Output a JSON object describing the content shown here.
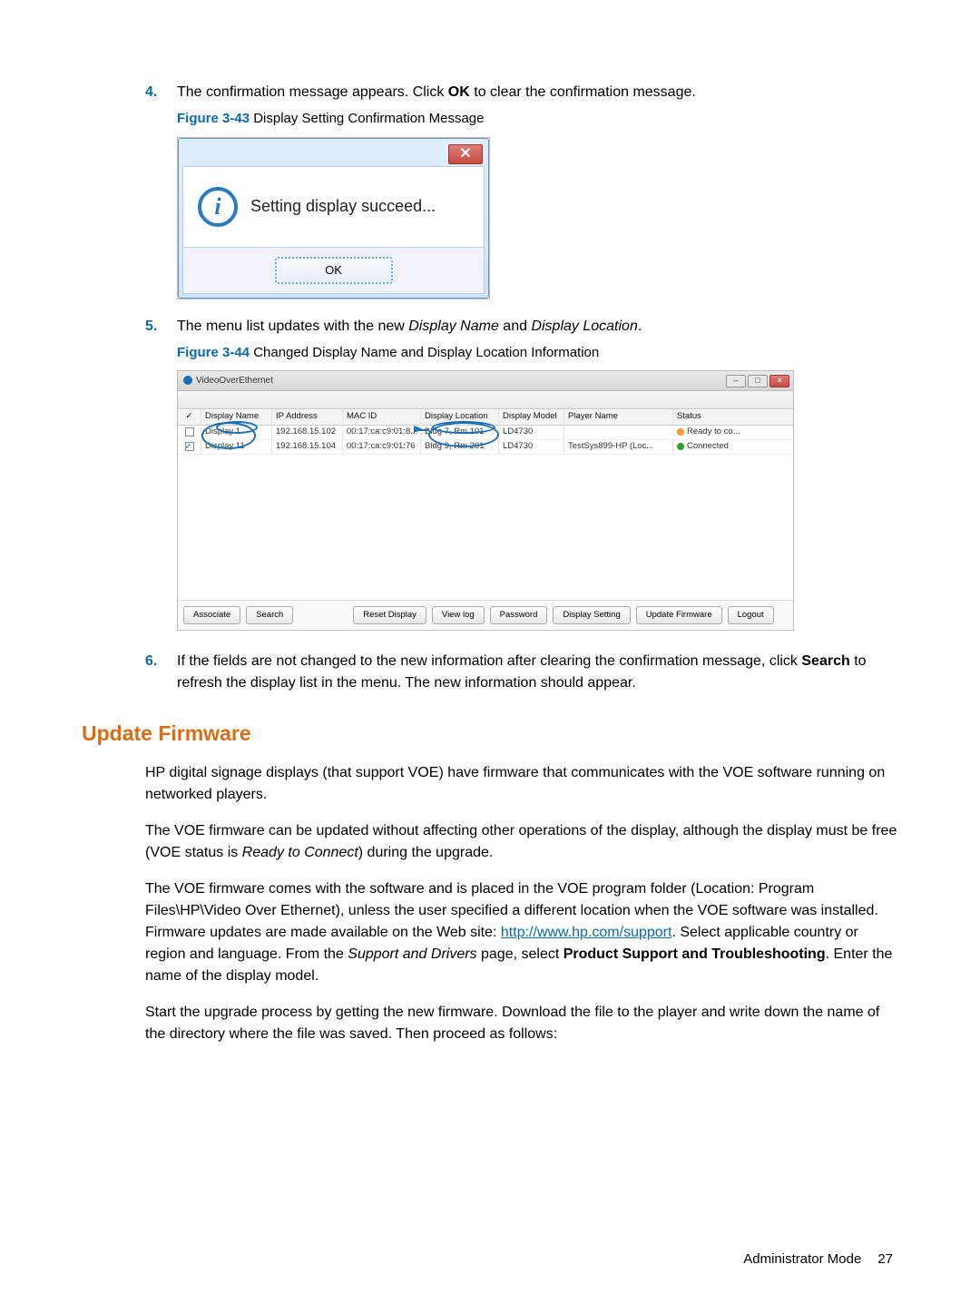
{
  "steps": {
    "s4": {
      "num": "4.",
      "text_a": "The confirmation message appears. Click ",
      "text_b": "OK",
      "text_c": " to clear the confirmation message."
    },
    "s5": {
      "num": "5.",
      "text_a": "The menu list updates with the new ",
      "i1": "Display Name",
      "text_b": " and ",
      "i2": "Display Location",
      "text_c": "."
    },
    "s6": {
      "num": "6.",
      "text_a": "If the fields are not changed to the new information after clearing the confirmation message, click ",
      "b1": "Search",
      "text_b": " to refresh the display list in the menu. The new information should appear."
    }
  },
  "fig43": {
    "prefix": "Figure 3-43",
    "caption": "  Display Setting Confirmation Message",
    "title": "",
    "message": "Setting display succeed...",
    "ok": "OK"
  },
  "fig44": {
    "prefix": "Figure 3-44",
    "caption": "  Changed Display Name and Display Location Information",
    "app_title": "VideoOverEthernet",
    "columns": {
      "chk": "✓",
      "name": "Display Name",
      "ip": "IP Address",
      "mac": "MAC ID",
      "loc": "Display Location",
      "model": "Display Model",
      "player": "Player Name",
      "status": "Status"
    },
    "rows": [
      {
        "checked": false,
        "name": "Display 1",
        "ip": "192.168.15.102",
        "mac": "00:17:ca:c9:01:8...",
        "loc": "Bldg 7, Rm 101",
        "model": "LD4730",
        "player": "",
        "status_icon": "info",
        "status": "Ready to co..."
      },
      {
        "checked": true,
        "name": "Display 11",
        "ip": "192.168.15.104",
        "mac": "00:17:ca:c9:01:76",
        "loc": "Bldg 9, Rm 201",
        "model": "LD4730",
        "player": "TestSys899-HP (Loc...",
        "status_icon": "ok",
        "status": "Connected"
      }
    ],
    "buttons": {
      "associate": "Associate",
      "search": "Search",
      "reset": "Reset Display",
      "viewlog": "View log",
      "password": "Password",
      "dispset": "Display Setting",
      "update": "Update Firmware",
      "logout": "Logout"
    }
  },
  "section": {
    "heading": "Update Firmware",
    "p1": "HP digital signage displays (that support VOE) have firmware that communicates with the VOE software running on networked players.",
    "p2_a": "The VOE firmware can be updated without affecting other operations of the display, although the display must be free (VOE status is ",
    "p2_i": "Ready to Connect",
    "p2_b": ") during the upgrade.",
    "p3_a": "The VOE firmware comes with the software and is placed in the VOE program folder (Location: Program Files\\HP\\Video Over Ethernet), unless the user specified a different location when the VOE software was installed. Firmware updates are made available on the Web site: ",
    "p3_link": "http://www.hp.com/support",
    "p3_b": ". Select applicable country or region and language. From the ",
    "p3_i": "Support and Drivers",
    "p3_c": " page, select ",
    "p3_bold1": "Product Support and Troubleshooting",
    "p3_d": ". Enter the name of the display model.",
    "p4": "Start the upgrade process by getting the new firmware. Download the file to the player and write down the name of the directory where the file was saved. Then proceed as follows:"
  },
  "footer": {
    "label": "Administrator Mode",
    "page": "27"
  }
}
